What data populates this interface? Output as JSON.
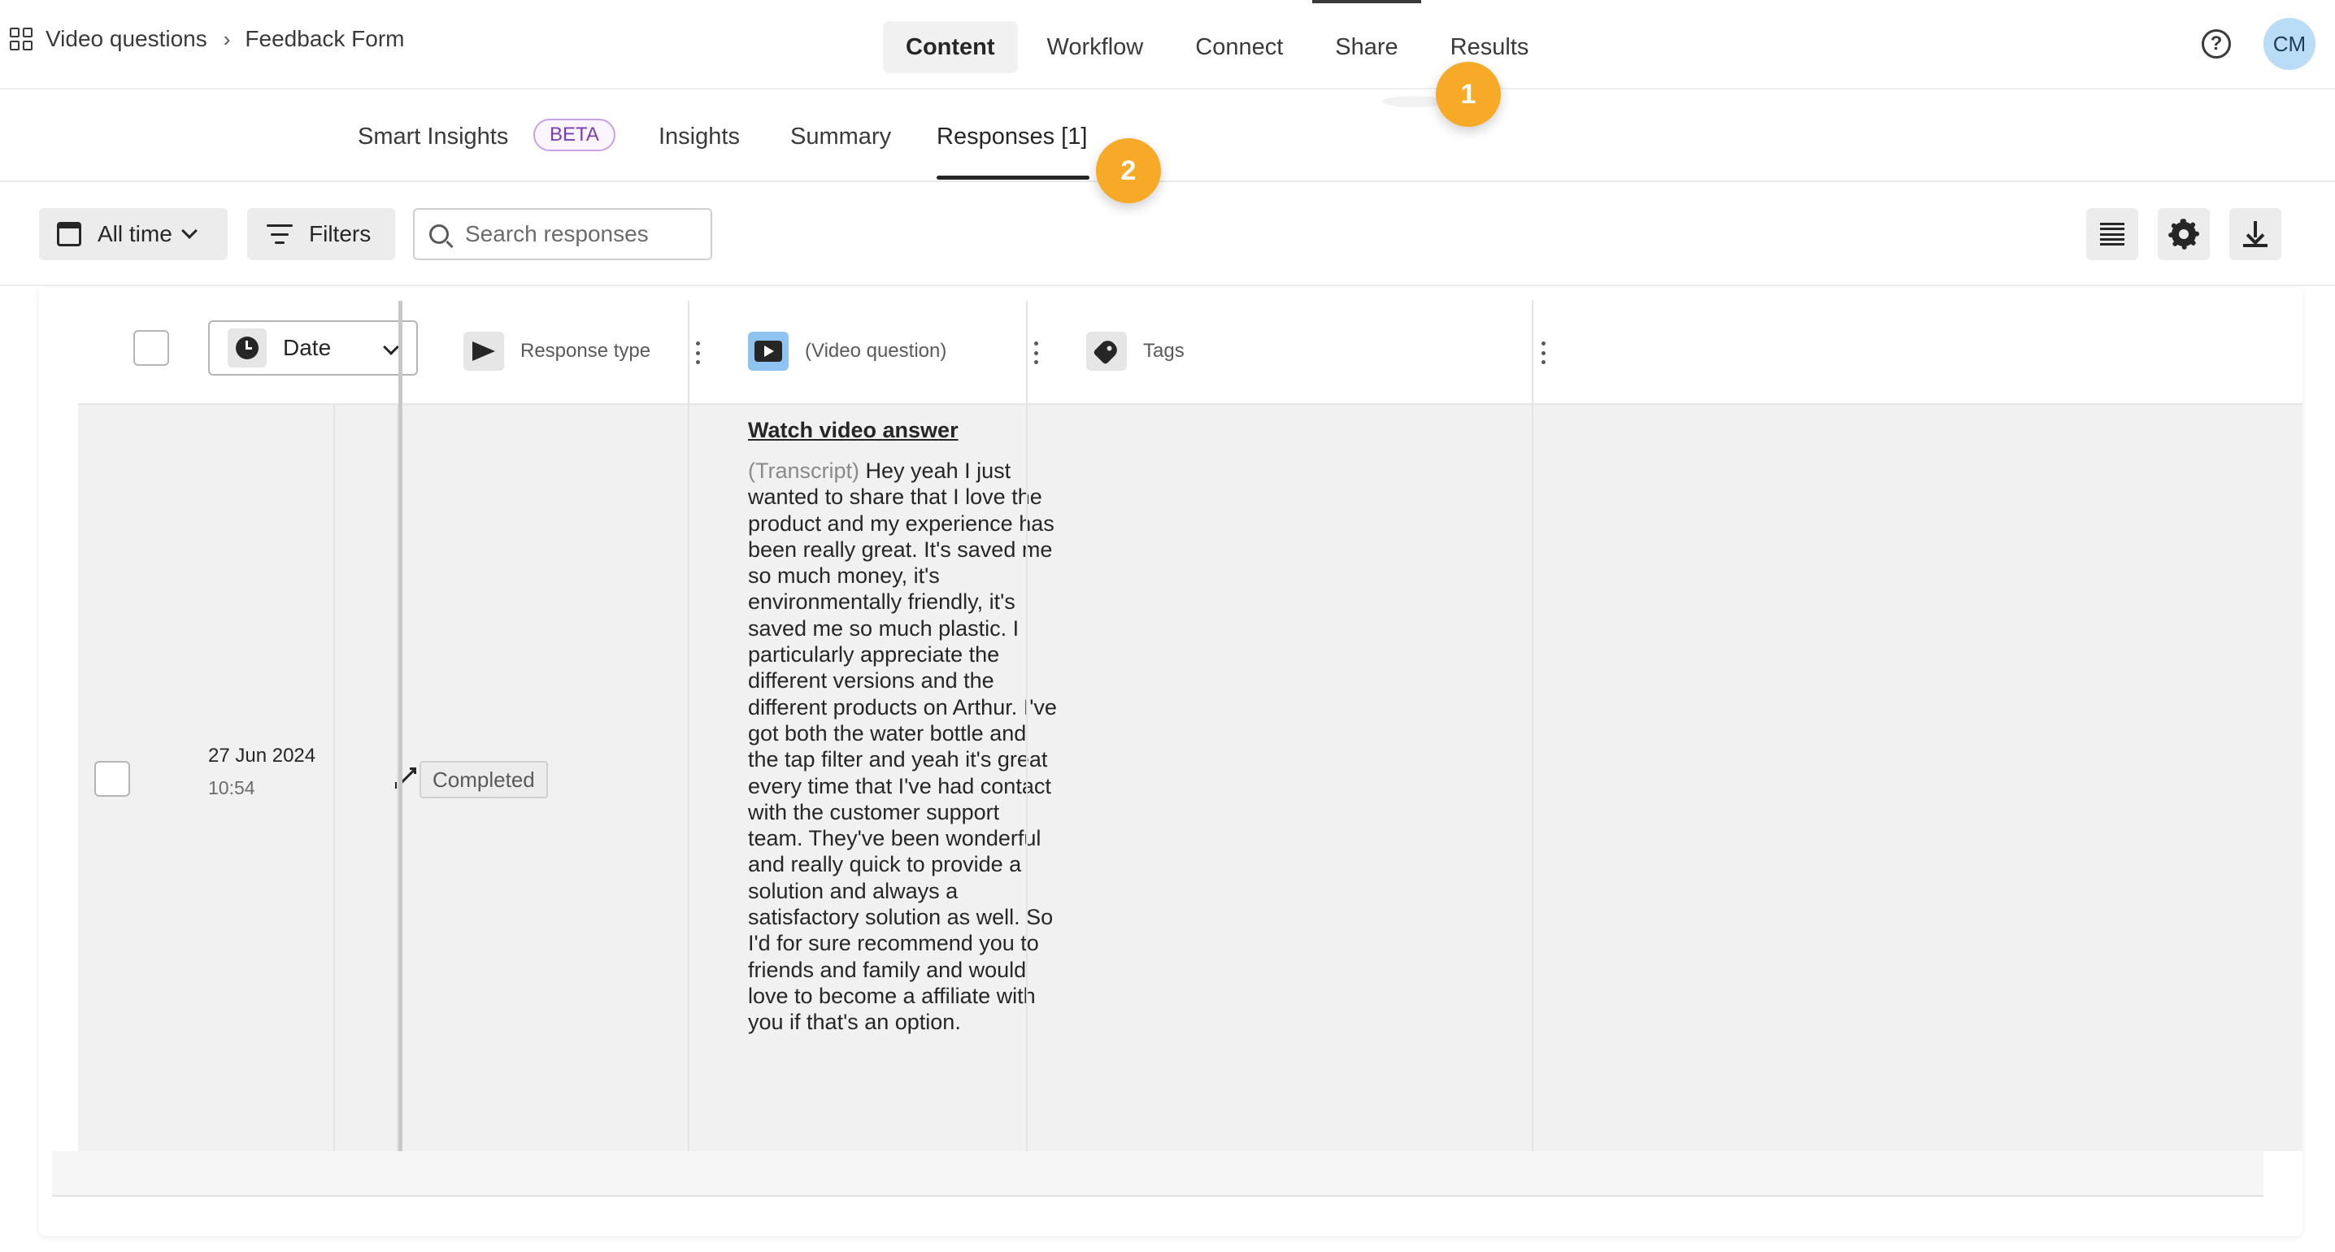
{
  "breadcrumb": {
    "parent": "Video questions",
    "current": "Feedback Form"
  },
  "nav": {
    "tabs": [
      "Content",
      "Workflow",
      "Connect",
      "Share",
      "Results"
    ],
    "active": "Content"
  },
  "user": {
    "initials": "CM"
  },
  "steps": {
    "one": "1",
    "two": "2"
  },
  "subtabs": {
    "smart_insights": "Smart Insights",
    "beta": "BETA",
    "insights": "Insights",
    "summary": "Summary",
    "responses": "Responses [1]"
  },
  "toolbar": {
    "all_time": "All time",
    "filters": "Filters",
    "search_placeholder": "Search responses"
  },
  "table": {
    "date_column": "Date",
    "columns": [
      "Response type",
      "(Video question)",
      "Tags"
    ],
    "rows": [
      {
        "date": "27 Jun 2024",
        "time": "10:54",
        "response_type": "Completed",
        "video_link": "Watch video answer",
        "transcript_label": "(Transcript)",
        "transcript": "Hey yeah I just wanted to share that I love the product and my experience has been really great. It's saved me so much money, it's environmentally friendly, it's saved me so much plastic. I particularly appreciate the different versions and the different products on Arthur. I've got both the water bottle and the tap filter and yeah it's great every time that I've had contact with the customer support team. They've been wonderful and really quick to provide a solution and always a satisfactory solution as well. So I'd for sure recommend you to friends and family and would love to become a affiliate with you if that's an option.",
        "tags": ""
      }
    ]
  },
  "colors": {
    "accent_badge": "#f7a928",
    "avatar_bg": "#b9dcf7",
    "beta_border": "#c9a2e6"
  },
  "icons": [
    "grid-icon",
    "chevron-right-icon",
    "help-icon",
    "calendar-icon",
    "chevron-down-icon",
    "filter-icon",
    "search-icon",
    "list-view-icon",
    "gear-icon",
    "download-icon",
    "clock-icon",
    "send-icon",
    "video-icon",
    "tag-icon",
    "kebab-icon",
    "expand-icon"
  ]
}
